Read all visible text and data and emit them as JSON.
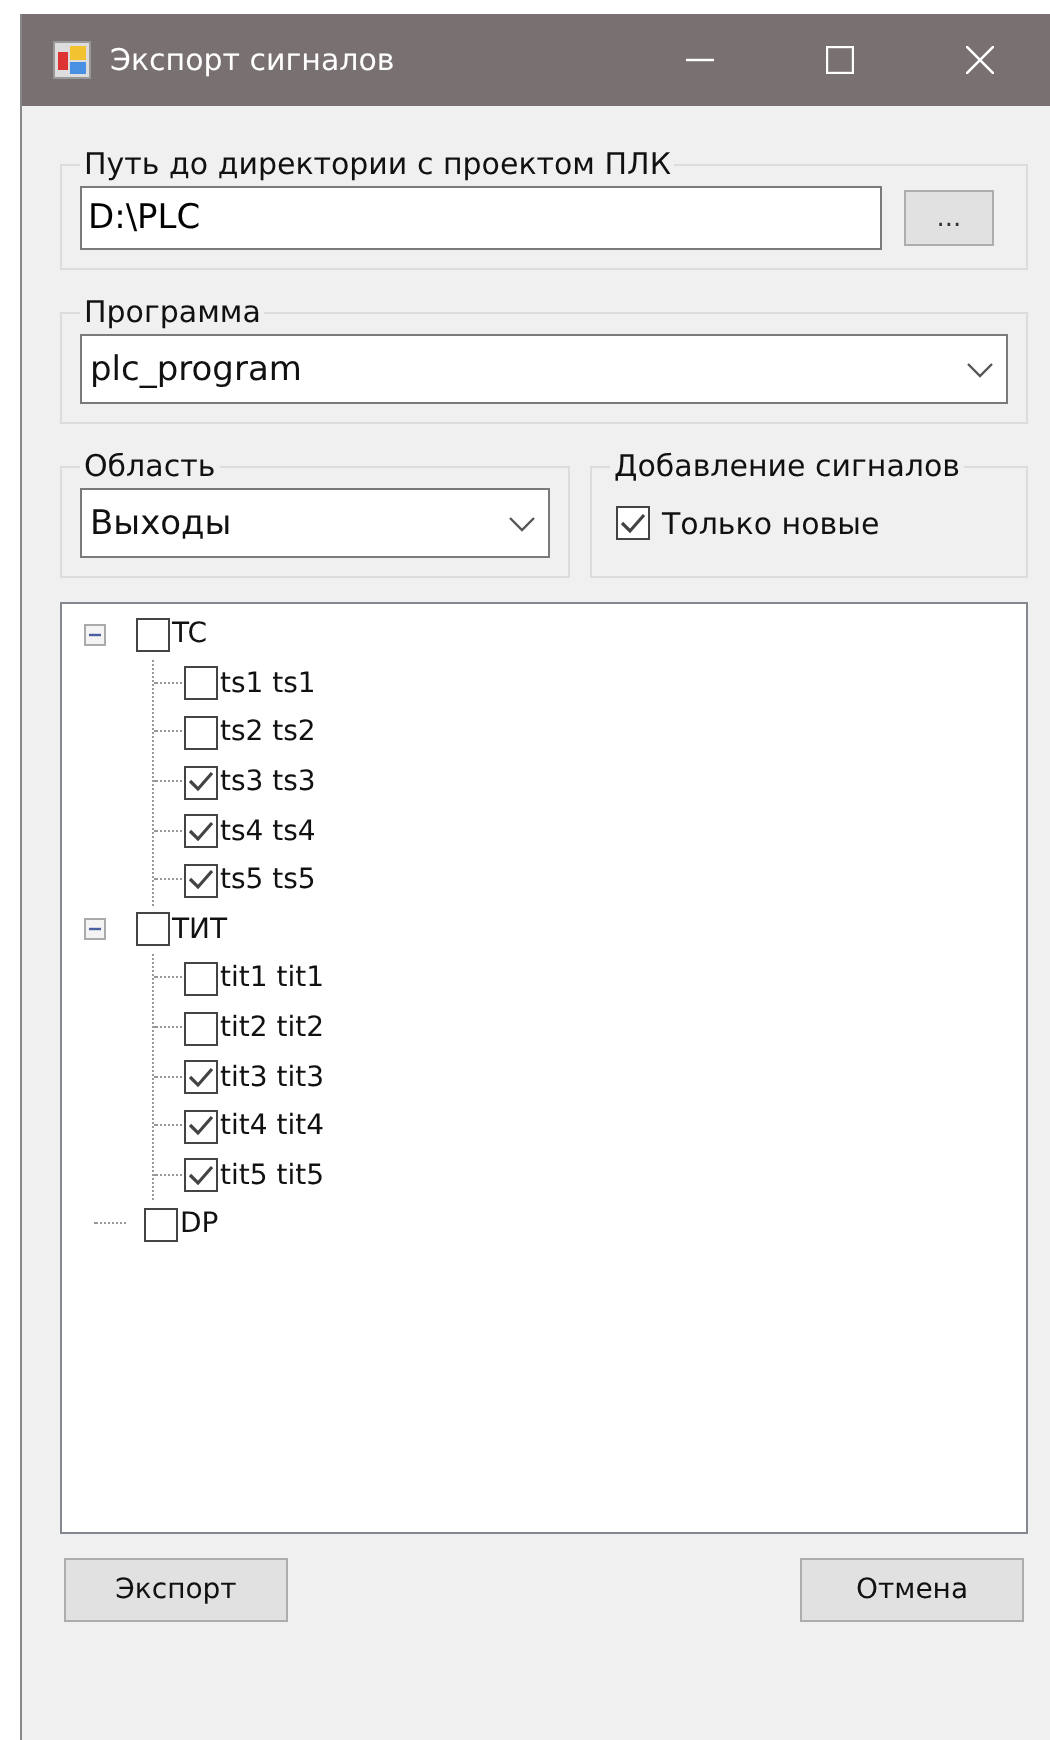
{
  "window": {
    "title": "Экспорт сигналов"
  },
  "path_group": {
    "label": "Путь до директории с проектом ПЛК",
    "value": "D:\\PLC",
    "browse_button": "..."
  },
  "program_group": {
    "label": "Программа",
    "value": "plc_program"
  },
  "area_group": {
    "label": "Область",
    "value": "Выходы"
  },
  "add_group": {
    "label": "Добавление сигналов",
    "checkbox": {
      "label": "Только новые",
      "checked": true
    }
  },
  "tree": [
    {
      "label": "TC",
      "checked": false,
      "expanded": true,
      "children": [
        {
          "label": "ts1 ts1",
          "checked": false
        },
        {
          "label": "ts2 ts2",
          "checked": false
        },
        {
          "label": "ts3 ts3",
          "checked": true
        },
        {
          "label": "ts4 ts4",
          "checked": true
        },
        {
          "label": "ts5 ts5",
          "checked": true
        }
      ]
    },
    {
      "label": "ТИТ",
      "checked": false,
      "expanded": true,
      "children": [
        {
          "label": "tit1 tit1",
          "checked": false
        },
        {
          "label": "tit2 tit2",
          "checked": false
        },
        {
          "label": "tit3 tit3",
          "checked": true
        },
        {
          "label": "tit4 tit4",
          "checked": true
        },
        {
          "label": "tit5 tit5",
          "checked": true
        }
      ]
    },
    {
      "label": "DP",
      "checked": false
    }
  ],
  "buttons": [
    "Экспорт",
    "Отмена"
  ]
}
